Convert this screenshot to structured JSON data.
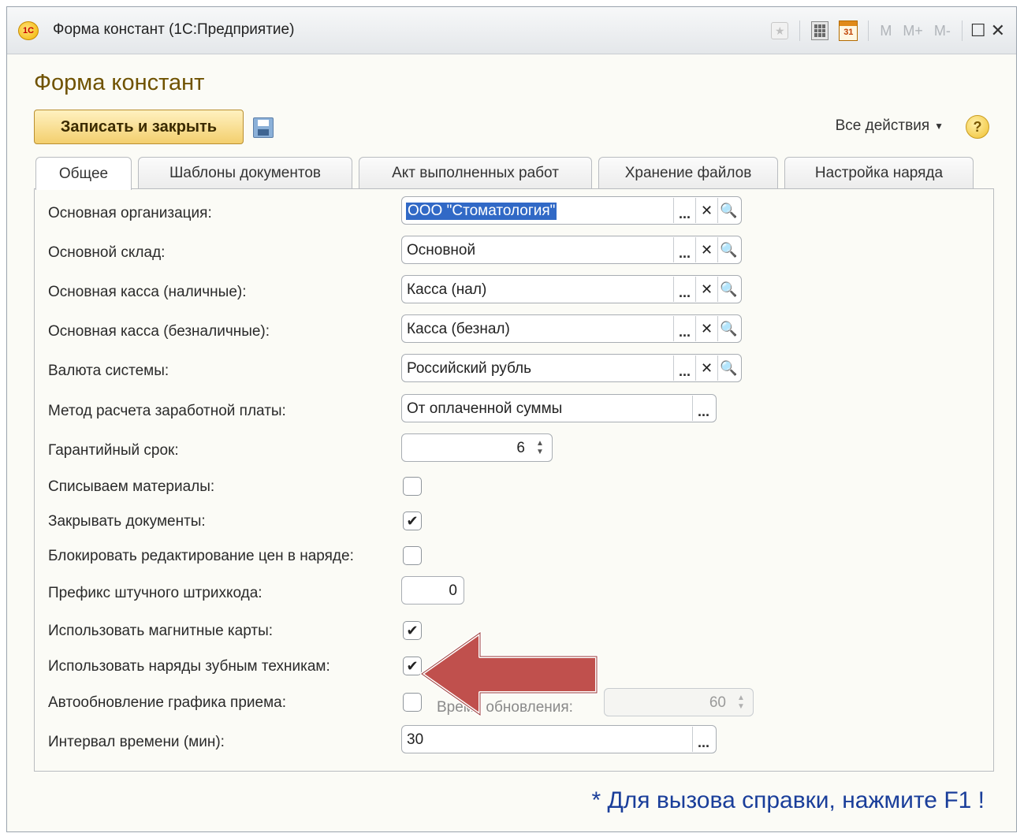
{
  "window": {
    "title": "Форма констант  (1С:Предприятие)",
    "logo_text": "1С",
    "toolbar": {
      "calendar_label": "31",
      "m_label": "M",
      "m_plus_label": "M+",
      "m_minus_label": "M-"
    }
  },
  "form": {
    "title": "Форма констант",
    "save_close_label": "Записать и закрыть",
    "all_actions_label": "Все действия",
    "help_label": "?"
  },
  "tabs": [
    {
      "label": "Общее",
      "active": true
    },
    {
      "label": "Шаблоны документов",
      "active": false
    },
    {
      "label": "Акт выполненных работ",
      "active": false
    },
    {
      "label": "Хранение файлов",
      "active": false
    },
    {
      "label": "Настройка наряда",
      "active": false
    }
  ],
  "fields": {
    "organization": {
      "label": "Основная организация:",
      "value": "ООО \"Стоматология\""
    },
    "warehouse": {
      "label": "Основной склад:",
      "value": "Основной"
    },
    "cash_cash": {
      "label": "Основная касса (наличные):",
      "value": "Касса (нал)"
    },
    "cash_noncash": {
      "label": "Основная касса (безналичные):",
      "value": "Касса (безнал)"
    },
    "currency": {
      "label": "Валюта системы:",
      "value": "Российский рубль"
    },
    "salary_method": {
      "label": "Метод расчета заработной платы:",
      "value": "От оплаченной суммы"
    },
    "warranty": {
      "label": "Гарантийный срок:",
      "value": "6"
    },
    "write_off": {
      "label": "Списываем материалы:",
      "checked": false
    },
    "close_docs": {
      "label": "Закрывать документы:",
      "checked": true
    },
    "lock_prices": {
      "label": "Блокировать редактирование цен в наряде:",
      "checked": false
    },
    "barcode_prefix": {
      "label": "Префикс штучного штрихкода:",
      "value": "0"
    },
    "magnetic_cards": {
      "label": "Использовать магнитные карты:",
      "checked": true
    },
    "technician_orders": {
      "label": "Использовать наряды зубным техникам:",
      "checked": true
    },
    "auto_refresh": {
      "label": "Автообновление графика приема:",
      "checked": false,
      "refresh_time_label": "Время обновления:",
      "refresh_time_value": "60"
    },
    "interval": {
      "label": "Интервал времени (мин):",
      "value": "30"
    }
  },
  "glyphs": {
    "dots": "...",
    "clear": "✕",
    "search": "🔍",
    "check": "✔",
    "spin": "▲▼"
  },
  "footer": {
    "hint": "* Для вызова справки, нажмите F1 !"
  },
  "colors": {
    "accent": "#6f5200",
    "button": "#f3cf6e",
    "arrow": "#c0504d",
    "hint": "#1a3e9a",
    "selection": "#3169c6"
  }
}
